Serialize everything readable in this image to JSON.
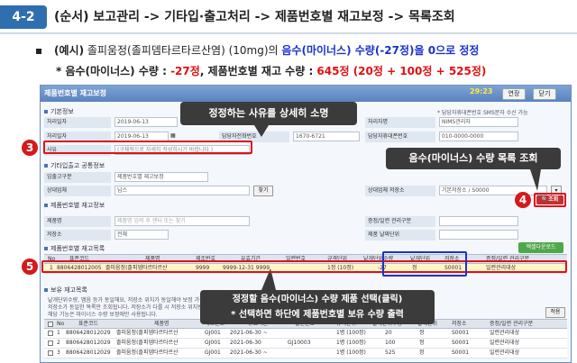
{
  "slide": {
    "section_no": "4-2",
    "title": "(순서) 보고관리 -> 기타입·출고처리 -> 제품번호별 재고보정 -> 목록조회",
    "example_prefix": "(예시)",
    "example_text": " 졸피움정(졸피뎀타르타르산염) (10mg)의 ",
    "example_highlight": "음수(마이너스) 수량(-27정)을 0으로 정정",
    "qty_line_a": "* 음수(마이너스) 수량 : ",
    "qty_neg": "-27정",
    "qty_line_b": ", 제품번호별 재고 수량 : ",
    "qty_total": "645정 (20정 + 100정 + 525정)"
  },
  "window": {
    "title": "제품번호별 재고보정",
    "time": "29:23",
    "extend_label": "연장",
    "close_label": "닫기"
  },
  "basic": {
    "header": "기본정보",
    "note": "* 담당자휴대폰번호 SMS문자 수신 가능",
    "report_date_label": "처리일자",
    "report_date": "2019-06-13",
    "reporter_label": "처리자명",
    "reporter": "NIMS관리자",
    "reg_date_label": "처리일자",
    "reg_date": "2019-06-13",
    "contact_label": "담당자전화번호",
    "contact": "1670-6721",
    "mobile_label": "담당자휴대폰번호",
    "mobile": "010-0000-0000",
    "reason_label": "사유",
    "reason_placeholder": "(구체적으로 자세히 작성하시기 바랍니다.)"
  },
  "inout": {
    "header": "기타입출고 공통정보",
    "type_label": "입출고구분",
    "type_value": "제품번호별 재고보정",
    "partner_label": "상대업체",
    "partner_value": "님스",
    "find_label": "찾기",
    "storage_label": "상대업체 저장소",
    "storage_value": "기본저장소 / S0000"
  },
  "product": {
    "header": "제품번호별 재고정보",
    "name_label": "제품명",
    "name_placeholder": "제품명 입력 후 엔터 또는 찾기",
    "code_label": "증정/일련 관리구분",
    "storage_label": "저장소",
    "storage_value": "전체",
    "lot_label": "제품 날짜단위",
    "search_label": "조회"
  },
  "list": {
    "header": "제품번호별 재고목록",
    "excel_label": "엑셀다운로드",
    "columns": [
      "No",
      "표준코드",
      "제품명",
      "제조번호",
      "유효기간",
      "일련번호",
      "규격단위",
      "낱개단위수량",
      "낱개단위",
      "저장소",
      "증정/일련 관리구분"
    ],
    "rows": [
      [
        "1",
        "8806428012005",
        "졸피움정(졸피뎀타르타르산",
        "9999",
        "9999-12-31 9999",
        "",
        "1정 (10정)",
        "-27",
        "정",
        "S0001",
        "일련관리대상"
      ]
    ]
  },
  "stock": {
    "header": "보유 재고목록",
    "notes": [
      "낱개단위수량, 맵음 등가 동일해요, 저장소 위치가 동일해야 보정 가능합니다.",
      "저장소가 동일한 목록만 조회됩니다. 저장소가 다를 시 저장소 위치변경 후 보정해 주세요.",
      "해당 기능은 마이너스 수량 보정에만 사용됩니다."
    ],
    "check_label": "적용",
    "columns": [
      "No",
      "표준코드",
      "제품명",
      "제조번호",
      "유효기간",
      "일련번호",
      "규격단위",
      "낱개단위수량",
      "낱개단위",
      "저장소",
      "증정/일련 관리구분"
    ],
    "rows": [
      [
        "1",
        "8806428012029",
        "졸피움정(졸피뎀타르타르산",
        "GJ001",
        "2021-06-30 ~",
        "",
        "1병 (100정)",
        "20",
        "정",
        "S0001",
        "일련관리대상"
      ],
      [
        "2",
        "8806428012029",
        "졸피움정(졸피뎀타르타르산",
        "GJ001",
        "2021-06-30",
        "GJ10003",
        "1병 (100정)",
        "100",
        "정",
        "S0001",
        "일련관리대상"
      ],
      [
        "3",
        "8806428012029",
        "졸피움정(졸피뎀타르타르산",
        "GJ001",
        "2021-06-30 ~",
        "",
        "1병 (100정)",
        "525",
        "정",
        "S0001",
        "일련관리대상"
      ]
    ]
  },
  "callouts": {
    "c3": "정정하는 사유를 상세히 소명",
    "c4": "음수(마이너스) 수량 목록 조회",
    "c5_line1": "정정할 음수(마이너스) 수량 제품 선택(클릭)",
    "c5_line2": "* 선택하면 하단에 제품번호별 보유 수량 출력",
    "n3": "3",
    "n4": "4",
    "n5": "5"
  },
  "colors": {
    "accent": "#2f6fb0",
    "highlight_red": "#e01010",
    "highlight_blue": "#1a33c8"
  }
}
